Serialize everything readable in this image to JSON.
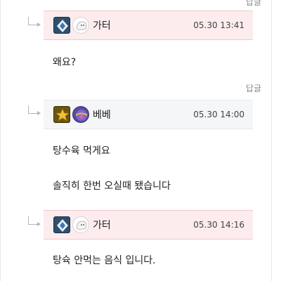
{
  "reply_label": "답글",
  "comments": [
    {
      "author": "가터",
      "time": "05.30 13:41",
      "header_style": "pink",
      "rank_icon": "diamond-rank-icon",
      "avatar_icon": "ghost-avatar-icon",
      "lines": [
        "왜요?"
      ]
    },
    {
      "author": "베베",
      "time": "05.30 14:00",
      "header_style": "gray",
      "rank_icon": "gold-star-rank-icon",
      "avatar_icon": "purple-ball-avatar-icon",
      "lines": [
        "탕수육 먹게요",
        "솔직히 한번 오실때 됐습니다"
      ]
    },
    {
      "author": "가터",
      "time": "05.30 14:16",
      "header_style": "pink",
      "rank_icon": "diamond-rank-icon",
      "avatar_icon": "ghost-avatar-icon",
      "lines": [
        "탕슉 안먹는 음식 입니다."
      ]
    }
  ],
  "colors": {
    "header_pink": "#fcecee",
    "header_gray": "#f5f6f8",
    "border_pink": "#f2c6cc",
    "reply_text": "#888888"
  }
}
